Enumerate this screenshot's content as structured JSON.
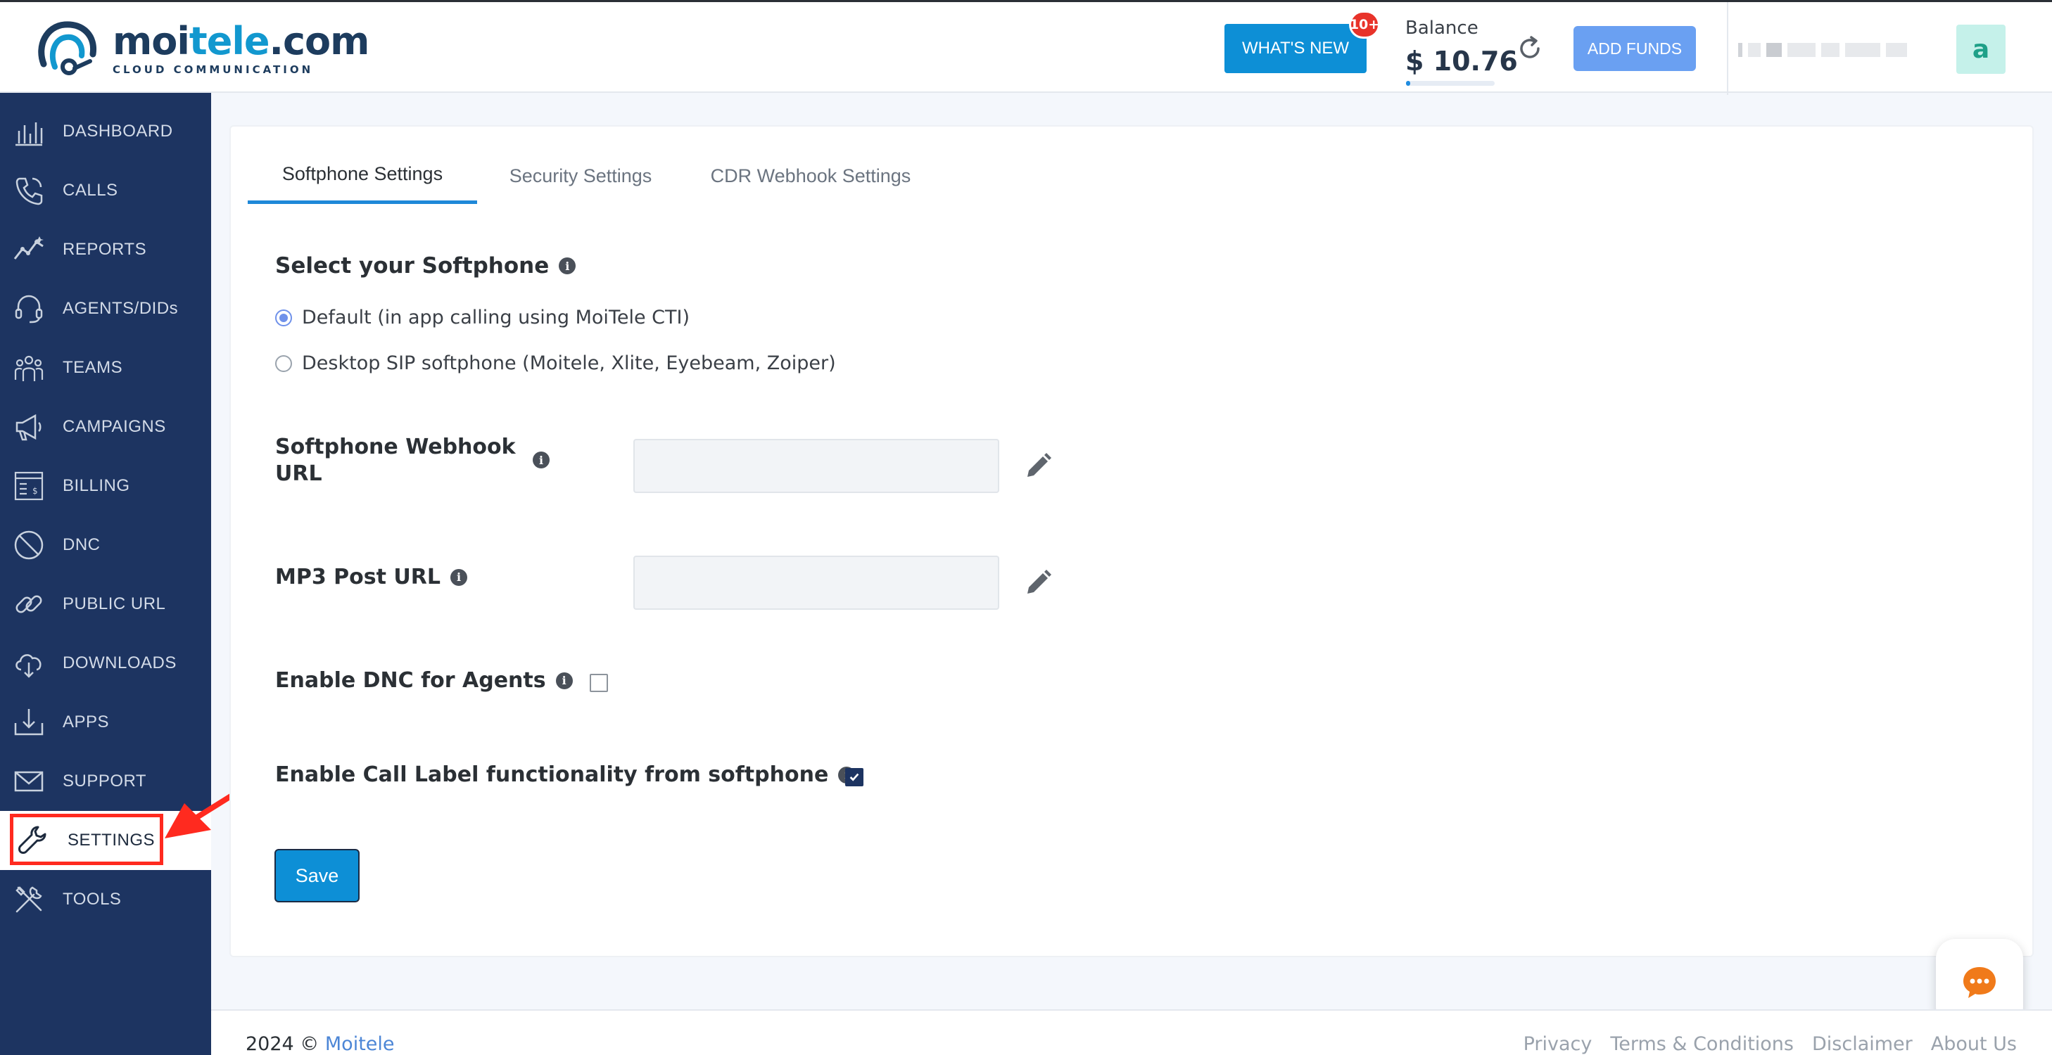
{
  "header": {
    "logo_brand_pre": "moi",
    "logo_brand_accent": "tele",
    "logo_brand_post": ".com",
    "logo_tagline": "CLOUD COMMUNICATION",
    "whats_new_label": "WHAT'S NEW",
    "whats_new_badge": "10+",
    "balance_label": "Balance",
    "balance_amount": "$ 10.76",
    "add_funds_label": "ADD FUNDS",
    "avatar_letter": "a"
  },
  "sidebar": {
    "items": [
      {
        "label": "DASHBOARD",
        "icon": "dashboard-icon"
      },
      {
        "label": "CALLS",
        "icon": "phone-icon"
      },
      {
        "label": "REPORTS",
        "icon": "chart-line-icon"
      },
      {
        "label": "AGENTS/DIDs",
        "icon": "headset-icon"
      },
      {
        "label": "TEAMS",
        "icon": "team-icon"
      },
      {
        "label": "CAMPAIGNS",
        "icon": "megaphone-icon"
      },
      {
        "label": "BILLING",
        "icon": "invoice-icon"
      },
      {
        "label": "DNC",
        "icon": "block-icon"
      },
      {
        "label": "PUBLIC URL",
        "icon": "link-icon"
      },
      {
        "label": "DOWNLOADS",
        "icon": "cloud-download-icon"
      },
      {
        "label": "APPS",
        "icon": "app-download-icon"
      },
      {
        "label": "SUPPORT",
        "icon": "envelope-icon"
      },
      {
        "label": "SETTINGS",
        "icon": "wrench-icon"
      },
      {
        "label": "TOOLS",
        "icon": "tools-icon"
      }
    ],
    "active": "SETTINGS"
  },
  "tabs": [
    {
      "label": "Softphone Settings",
      "active": true
    },
    {
      "label": "Security Settings",
      "active": false
    },
    {
      "label": "CDR Webhook Settings",
      "active": false
    }
  ],
  "form": {
    "softphone_title": "Select your Softphone",
    "radio_default": "Default (in app calling using MoiTele CTI)",
    "radio_desktop": "Desktop SIP softphone (Moitele, Xlite, Eyebeam, Zoiper)",
    "selected_softphone": "default",
    "webhook_label_line1": "Softphone Webhook",
    "webhook_label_line2": "URL",
    "webhook_value": "",
    "mp3_label": "MP3 Post URL",
    "mp3_value": "",
    "dnc_label": "Enable DNC for Agents",
    "dnc_checked": false,
    "call_label_label": "Enable Call Label functionality from softphone",
    "call_label_checked": true,
    "save_label": "Save"
  },
  "footer": {
    "copyright_prefix": "2024 © ",
    "copyright_link": "Moitele",
    "links": [
      "Privacy",
      "Terms & Conditions",
      "Disclaimer",
      "About Us"
    ]
  },
  "colors": {
    "sidebar_bg": "#1d3461",
    "primary": "#0d8fd6",
    "tab_accent": "#1e88d8",
    "highlight": "#ff2a1f",
    "chat_icon": "#f07a1a"
  }
}
